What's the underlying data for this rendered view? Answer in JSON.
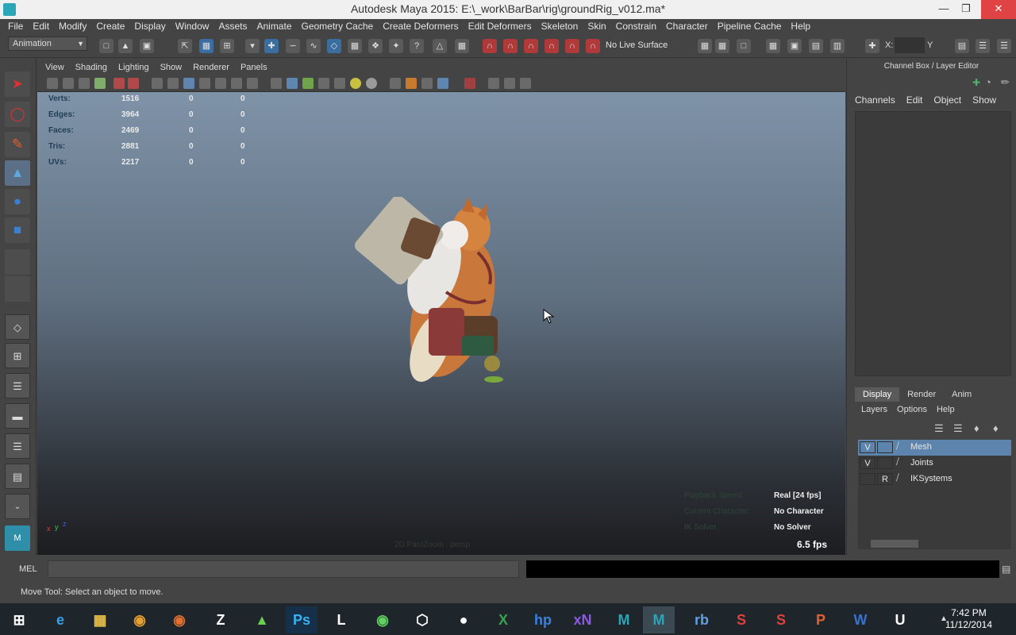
{
  "window": {
    "title": "Autodesk Maya 2015: E:\\_work\\BarBar\\rig\\groundRig_v012.ma*"
  },
  "menubar": [
    "File",
    "Edit",
    "Modify",
    "Create",
    "Display",
    "Window",
    "Assets",
    "Animate",
    "Geometry Cache",
    "Create Deformers",
    "Edit Deformers",
    "Skeleton",
    "Skin",
    "Constrain",
    "Character",
    "Pipeline Cache",
    "Help"
  ],
  "statusline": {
    "mode": "Animation",
    "live_surface": "No Live Surface",
    "x_label": "X:",
    "y_label": "Y"
  },
  "viewport": {
    "menu": [
      "View",
      "Shading",
      "Lighting",
      "Show",
      "Renderer",
      "Panels"
    ],
    "hud": [
      {
        "label": "Verts:",
        "v1": "1516",
        "v2": "0",
        "v3": "0"
      },
      {
        "label": "Edges:",
        "v1": "3964",
        "v2": "0",
        "v3": "0"
      },
      {
        "label": "Faces:",
        "v1": "2469",
        "v2": "0",
        "v3": "0"
      },
      {
        "label": "Tris:",
        "v1": "2881",
        "v2": "0",
        "v3": "0"
      },
      {
        "label": "UVs:",
        "v1": "2217",
        "v2": "0",
        "v3": "0"
      }
    ],
    "hud_right": {
      "playback": "Real [24 fps]",
      "character": "No Character",
      "solver": "No Solver"
    },
    "hud_ghost": [
      "Playback Speed:",
      "Current Character:",
      "IK Solver:"
    ],
    "fps": "6.5 fps",
    "camera": "2D Pan/Zoom : persp",
    "axis": {
      "x": "x",
      "y": "y",
      "z": "z"
    }
  },
  "channel_box": {
    "title": "Channel Box / Layer Editor",
    "menu": [
      "Channels",
      "Edit",
      "Object",
      "Show"
    ],
    "tabs": [
      "Display",
      "Render",
      "Anim"
    ],
    "layer_menu": [
      "Layers",
      "Options",
      "Help"
    ],
    "layers": [
      {
        "vis": "V",
        "mode": "",
        "name": "Mesh",
        "selected": true
      },
      {
        "vis": "V",
        "mode": "",
        "name": "Joints",
        "selected": false
      },
      {
        "vis": "",
        "mode": "R",
        "name": "IKSystems",
        "selected": false
      }
    ]
  },
  "commandline": {
    "label": "MEL"
  },
  "helpline": {
    "text": "Move Tool: Select an object to move."
  },
  "taskbar": {
    "time": "7:42 PM",
    "date": "11/12/2014"
  },
  "colors": {
    "selected_layer": "#5d84ad",
    "viewport_top": "#7f93a8",
    "viewport_bottom": "#1c1d20",
    "close_button": "#e04343"
  }
}
